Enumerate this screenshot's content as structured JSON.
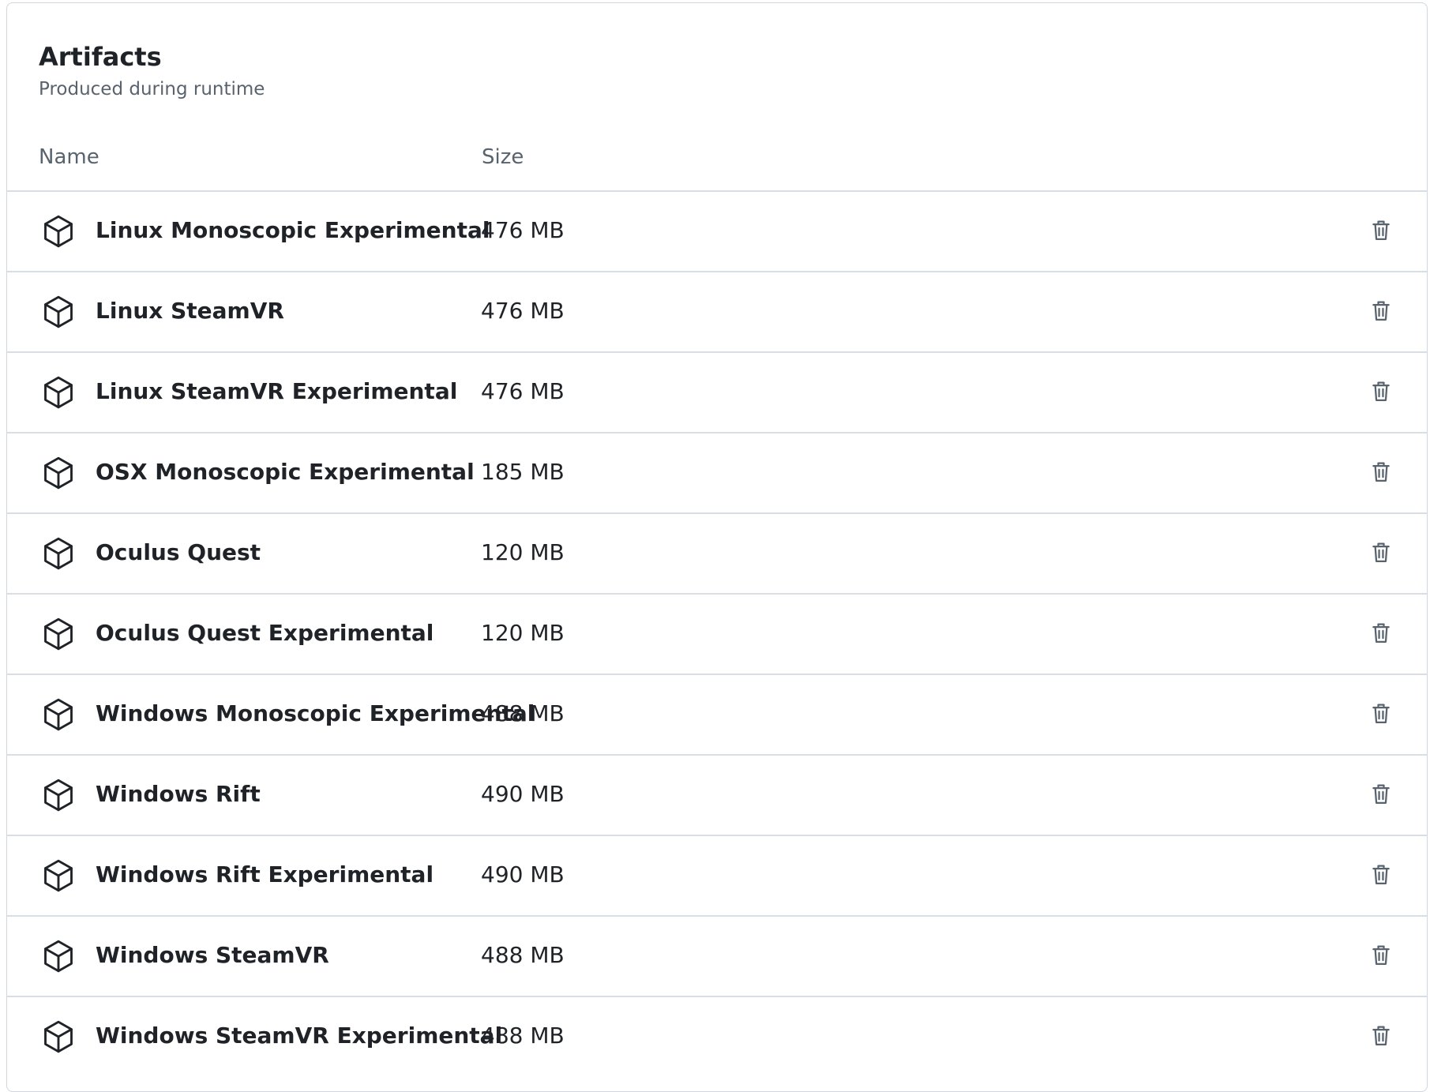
{
  "panel": {
    "title": "Artifacts",
    "subtitle": "Produced during runtime"
  },
  "columns": {
    "name": "Name",
    "size": "Size"
  },
  "icons": {
    "artifact": "package-icon",
    "delete": "trash-icon"
  },
  "colors": {
    "text": "#1f2328",
    "muted": "#59636e",
    "border": "#d0d7de"
  },
  "artifacts": [
    {
      "name": "Linux Monoscopic Experimental",
      "size": "476 MB"
    },
    {
      "name": "Linux SteamVR",
      "size": "476 MB"
    },
    {
      "name": "Linux SteamVR Experimental",
      "size": "476 MB"
    },
    {
      "name": "OSX Monoscopic Experimental",
      "size": "185 MB"
    },
    {
      "name": "Oculus Quest",
      "size": "120 MB"
    },
    {
      "name": "Oculus Quest Experimental",
      "size": "120 MB"
    },
    {
      "name": "Windows Monoscopic Experimental",
      "size": "488 MB"
    },
    {
      "name": "Windows Rift",
      "size": "490 MB"
    },
    {
      "name": "Windows Rift Experimental",
      "size": "490 MB"
    },
    {
      "name": "Windows SteamVR",
      "size": "488 MB"
    },
    {
      "name": "Windows SteamVR Experimental",
      "size": "488 MB"
    }
  ]
}
